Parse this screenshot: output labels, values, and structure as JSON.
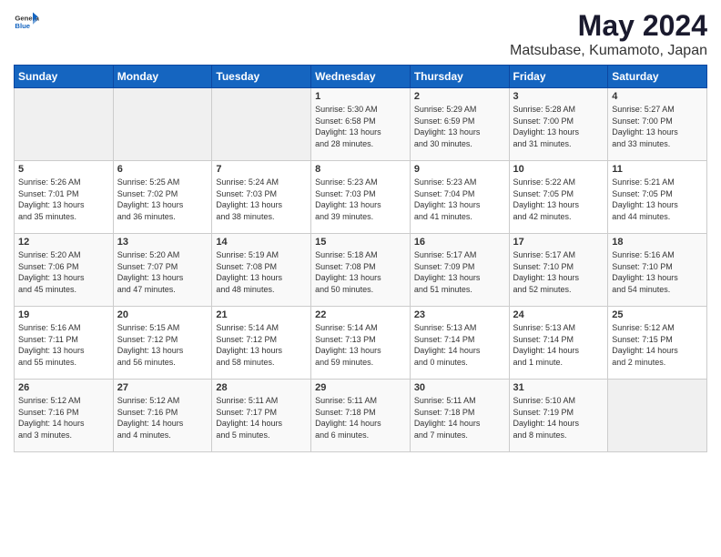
{
  "header": {
    "logo_general": "General",
    "logo_blue": "Blue",
    "title": "May 2024",
    "subtitle": "Matsubase, Kumamoto, Japan"
  },
  "calendar": {
    "columns": [
      "Sunday",
      "Monday",
      "Tuesday",
      "Wednesday",
      "Thursday",
      "Friday",
      "Saturday"
    ],
    "weeks": [
      [
        {
          "day": "",
          "info": ""
        },
        {
          "day": "",
          "info": ""
        },
        {
          "day": "",
          "info": ""
        },
        {
          "day": "1",
          "info": "Sunrise: 5:30 AM\nSunset: 6:58 PM\nDaylight: 13 hours\nand 28 minutes."
        },
        {
          "day": "2",
          "info": "Sunrise: 5:29 AM\nSunset: 6:59 PM\nDaylight: 13 hours\nand 30 minutes."
        },
        {
          "day": "3",
          "info": "Sunrise: 5:28 AM\nSunset: 7:00 PM\nDaylight: 13 hours\nand 31 minutes."
        },
        {
          "day": "4",
          "info": "Sunrise: 5:27 AM\nSunset: 7:00 PM\nDaylight: 13 hours\nand 33 minutes."
        }
      ],
      [
        {
          "day": "5",
          "info": "Sunrise: 5:26 AM\nSunset: 7:01 PM\nDaylight: 13 hours\nand 35 minutes."
        },
        {
          "day": "6",
          "info": "Sunrise: 5:25 AM\nSunset: 7:02 PM\nDaylight: 13 hours\nand 36 minutes."
        },
        {
          "day": "7",
          "info": "Sunrise: 5:24 AM\nSunset: 7:03 PM\nDaylight: 13 hours\nand 38 minutes."
        },
        {
          "day": "8",
          "info": "Sunrise: 5:23 AM\nSunset: 7:03 PM\nDaylight: 13 hours\nand 39 minutes."
        },
        {
          "day": "9",
          "info": "Sunrise: 5:23 AM\nSunset: 7:04 PM\nDaylight: 13 hours\nand 41 minutes."
        },
        {
          "day": "10",
          "info": "Sunrise: 5:22 AM\nSunset: 7:05 PM\nDaylight: 13 hours\nand 42 minutes."
        },
        {
          "day": "11",
          "info": "Sunrise: 5:21 AM\nSunset: 7:05 PM\nDaylight: 13 hours\nand 44 minutes."
        }
      ],
      [
        {
          "day": "12",
          "info": "Sunrise: 5:20 AM\nSunset: 7:06 PM\nDaylight: 13 hours\nand 45 minutes."
        },
        {
          "day": "13",
          "info": "Sunrise: 5:20 AM\nSunset: 7:07 PM\nDaylight: 13 hours\nand 47 minutes."
        },
        {
          "day": "14",
          "info": "Sunrise: 5:19 AM\nSunset: 7:08 PM\nDaylight: 13 hours\nand 48 minutes."
        },
        {
          "day": "15",
          "info": "Sunrise: 5:18 AM\nSunset: 7:08 PM\nDaylight: 13 hours\nand 50 minutes."
        },
        {
          "day": "16",
          "info": "Sunrise: 5:17 AM\nSunset: 7:09 PM\nDaylight: 13 hours\nand 51 minutes."
        },
        {
          "day": "17",
          "info": "Sunrise: 5:17 AM\nSunset: 7:10 PM\nDaylight: 13 hours\nand 52 minutes."
        },
        {
          "day": "18",
          "info": "Sunrise: 5:16 AM\nSunset: 7:10 PM\nDaylight: 13 hours\nand 54 minutes."
        }
      ],
      [
        {
          "day": "19",
          "info": "Sunrise: 5:16 AM\nSunset: 7:11 PM\nDaylight: 13 hours\nand 55 minutes."
        },
        {
          "day": "20",
          "info": "Sunrise: 5:15 AM\nSunset: 7:12 PM\nDaylight: 13 hours\nand 56 minutes."
        },
        {
          "day": "21",
          "info": "Sunrise: 5:14 AM\nSunset: 7:12 PM\nDaylight: 13 hours\nand 58 minutes."
        },
        {
          "day": "22",
          "info": "Sunrise: 5:14 AM\nSunset: 7:13 PM\nDaylight: 13 hours\nand 59 minutes."
        },
        {
          "day": "23",
          "info": "Sunrise: 5:13 AM\nSunset: 7:14 PM\nDaylight: 14 hours\nand 0 minutes."
        },
        {
          "day": "24",
          "info": "Sunrise: 5:13 AM\nSunset: 7:14 PM\nDaylight: 14 hours\nand 1 minute."
        },
        {
          "day": "25",
          "info": "Sunrise: 5:12 AM\nSunset: 7:15 PM\nDaylight: 14 hours\nand 2 minutes."
        }
      ],
      [
        {
          "day": "26",
          "info": "Sunrise: 5:12 AM\nSunset: 7:16 PM\nDaylight: 14 hours\nand 3 minutes."
        },
        {
          "day": "27",
          "info": "Sunrise: 5:12 AM\nSunset: 7:16 PM\nDaylight: 14 hours\nand 4 minutes."
        },
        {
          "day": "28",
          "info": "Sunrise: 5:11 AM\nSunset: 7:17 PM\nDaylight: 14 hours\nand 5 minutes."
        },
        {
          "day": "29",
          "info": "Sunrise: 5:11 AM\nSunset: 7:18 PM\nDaylight: 14 hours\nand 6 minutes."
        },
        {
          "day": "30",
          "info": "Sunrise: 5:11 AM\nSunset: 7:18 PM\nDaylight: 14 hours\nand 7 minutes."
        },
        {
          "day": "31",
          "info": "Sunrise: 5:10 AM\nSunset: 7:19 PM\nDaylight: 14 hours\nand 8 minutes."
        },
        {
          "day": "",
          "info": ""
        }
      ]
    ]
  }
}
